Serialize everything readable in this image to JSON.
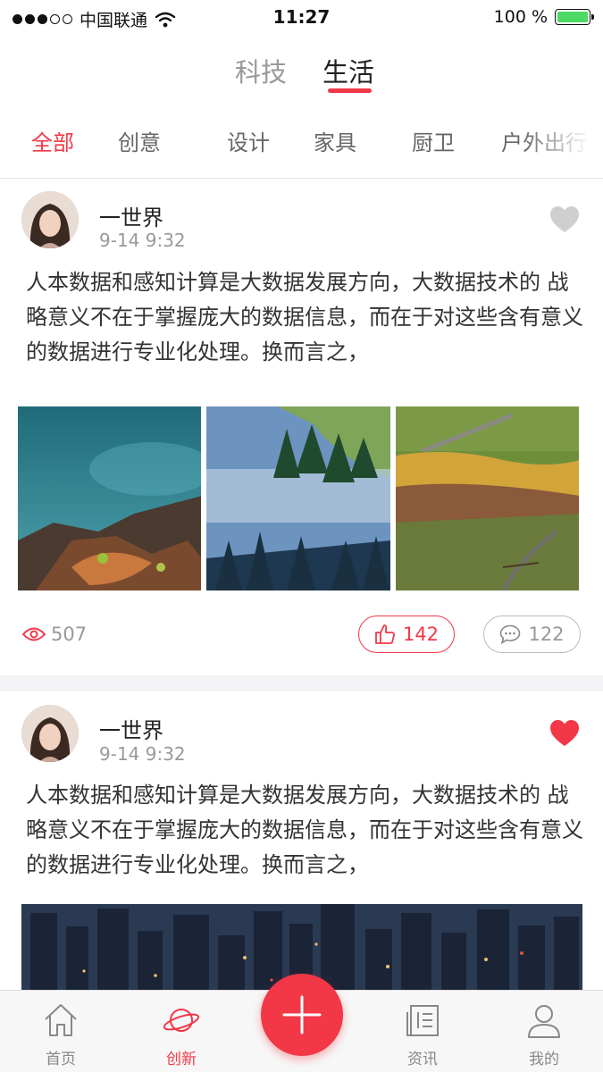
{
  "status_bar": {
    "carrier": "中国联通",
    "time": "11:27",
    "battery": "100 %",
    "signal_bars_filled": 3,
    "signal_bars_total": 5,
    "battery_level": 1.0
  },
  "top_tabs": [
    {
      "label": "科技",
      "active": false
    },
    {
      "label": "生活",
      "active": true
    }
  ],
  "categories": [
    {
      "label": "全部",
      "active": true
    },
    {
      "label": "创意",
      "active": false
    },
    {
      "label": "设计",
      "active": false
    },
    {
      "label": "家具",
      "active": false
    },
    {
      "label": "厨卫",
      "active": false
    },
    {
      "label": "户外出行",
      "active": false
    }
  ],
  "posts": [
    {
      "author": "一世界",
      "time": "9-14  9:32",
      "liked": false,
      "text": "人本数据和感知计算是大数据发展方向，大数据技术的 战略意义不在于掌握庞大的数据信息，而在于对这些含有意义的数据进行专业化处理。换而言之，",
      "views": "507",
      "likes": "142",
      "comments": "122"
    },
    {
      "author": "一世界",
      "time": "9-14  9:32",
      "liked": true,
      "text": "人本数据和感知计算是大数据发展方向，大数据技术的 战略意义不在于掌握庞大的数据信息，而在于对这些含有意义的数据进行专业化处理。换而言之，"
    }
  ],
  "tab_bar": {
    "items": [
      {
        "label": "首页",
        "icon": "home-icon",
        "active": false
      },
      {
        "label": "创新",
        "icon": "planet-icon",
        "active": true
      },
      {
        "label": "资讯",
        "icon": "news-icon",
        "active": false
      },
      {
        "label": "我的",
        "icon": "user-icon",
        "active": false
      }
    ],
    "fab_icon": "plus-icon"
  },
  "colors": {
    "accent": "#f23847",
    "muted": "#999999",
    "battery": "#4cd964"
  }
}
